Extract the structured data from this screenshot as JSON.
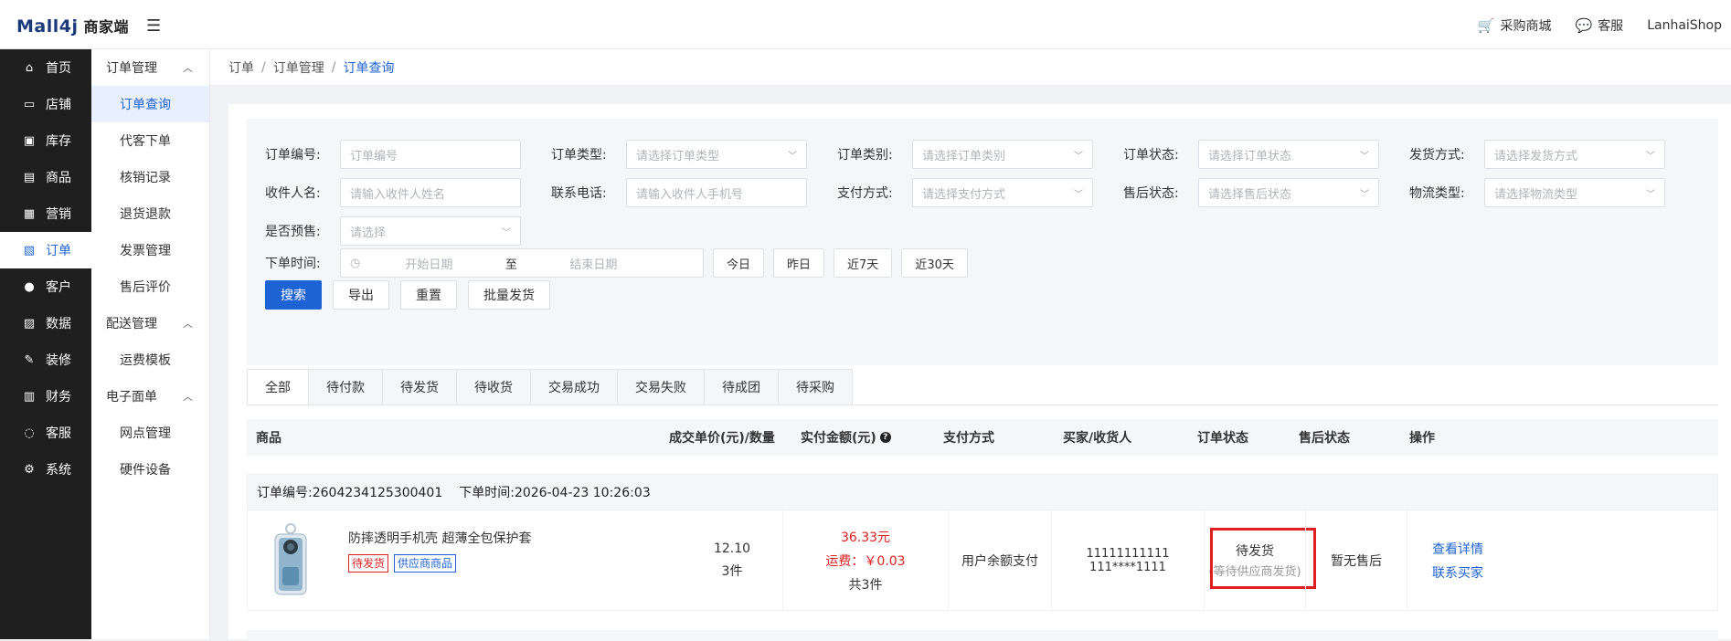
{
  "header": {
    "logo": "Mall4j",
    "logo_sub": "商家端",
    "links": [
      {
        "label": "采购商城",
        "icon": "cart-icon"
      },
      {
        "label": "客服",
        "icon": "chat-icon"
      }
    ],
    "username": "LanhaiShop"
  },
  "sidebar": {
    "items": [
      {
        "label": "首页",
        "icon": "home-icon"
      },
      {
        "label": "店铺",
        "icon": "shop-icon"
      },
      {
        "label": "库存",
        "icon": "inventory-icon"
      },
      {
        "label": "商品",
        "icon": "goods-icon"
      },
      {
        "label": "营销",
        "icon": "gift-icon"
      },
      {
        "label": "订单",
        "icon": "order-icon",
        "active": true
      },
      {
        "label": "客户",
        "icon": "user-icon"
      },
      {
        "label": "数据",
        "icon": "data-icon"
      },
      {
        "label": "装修",
        "icon": "decor-icon"
      },
      {
        "label": "财务",
        "icon": "finance-icon"
      },
      {
        "label": "客服",
        "icon": "service-icon"
      },
      {
        "label": "系统",
        "icon": "settings-icon"
      }
    ]
  },
  "subnav": {
    "group1": "订单管理",
    "group1_items": [
      "订单查询",
      "代客下单",
      "核销记录",
      "退货退款",
      "发票管理",
      "售后评价"
    ],
    "group2": "配送管理",
    "group2_items": [
      "运费模板"
    ],
    "group3": "电子面单",
    "group3_items": [
      "网点管理",
      "硬件设备"
    ]
  },
  "breadcrumb": {
    "items": [
      "订单",
      "订单管理"
    ],
    "current": "订单查询",
    "sep": "/"
  },
  "filters": {
    "row1": [
      {
        "label": "订单编号:",
        "placeholder": "订单编号",
        "select": false
      },
      {
        "label": "订单类型:",
        "placeholder": "请选择订单类型",
        "select": true
      },
      {
        "label": "订单类别:",
        "placeholder": "请选择订单类别",
        "select": true
      },
      {
        "label": "订单状态:",
        "placeholder": "请选择订单状态",
        "select": true
      },
      {
        "label": "发货方式:",
        "placeholder": "请选择发货方式",
        "select": true
      }
    ],
    "row2": [
      {
        "label": "收件人名:",
        "placeholder": "请输入收件人姓名",
        "select": false
      },
      {
        "label": "联系电话:",
        "placeholder": "请输入收件人手机号",
        "select": false
      },
      {
        "label": "支付方式:",
        "placeholder": "请选择支付方式",
        "select": true
      },
      {
        "label": "售后状态:",
        "placeholder": "请选择售后状态",
        "select": true
      },
      {
        "label": "物流类型:",
        "placeholder": "请选择物流类型",
        "select": true
      }
    ],
    "presale_label": "是否预售:",
    "presale_placeholder": "请选择",
    "date_label": "下单时间:",
    "date_start": "开始日期",
    "date_to": "至",
    "date_end": "结束日期",
    "quick": [
      "今日",
      "昨日",
      "近7天",
      "近30天"
    ],
    "actions": {
      "search": "搜索",
      "export": "导出",
      "reset": "重置",
      "batch": "批量发货"
    }
  },
  "tabs": [
    "全部",
    "待付款",
    "待发货",
    "待收货",
    "交易成功",
    "交易失败",
    "待成团",
    "待采购"
  ],
  "table": {
    "headers": {
      "product": "商品",
      "price_qty": "成交单价(元)/数量",
      "paid": "实付金额(元)",
      "pay_method": "支付方式",
      "buyer": "买家/收货人",
      "status": "订单状态",
      "after_sale": "售后状态",
      "ops": "操作"
    }
  },
  "order": {
    "number_text": "订单编号:2604234125300401",
    "time_text": "下单时间:2026-04-23 10:26:03",
    "product_name": "防摔透明手机壳 超薄全包保护套",
    "tag1": "待发货",
    "tag2": "供应商商品",
    "unit_price": "12.10",
    "qty": "3件",
    "paid_amount": "36.33元",
    "freight": "运费：￥0.03",
    "total_qty": "共3件",
    "pay_method": "用户余额支付",
    "buyer_line1": "11111111111",
    "buyer_line2": "111****1111",
    "status": "待发货",
    "status_sub": "(等待供应商发货)",
    "after_sale": "暂无售后",
    "op_detail": "查看详情",
    "op_contact": "联系买家"
  }
}
